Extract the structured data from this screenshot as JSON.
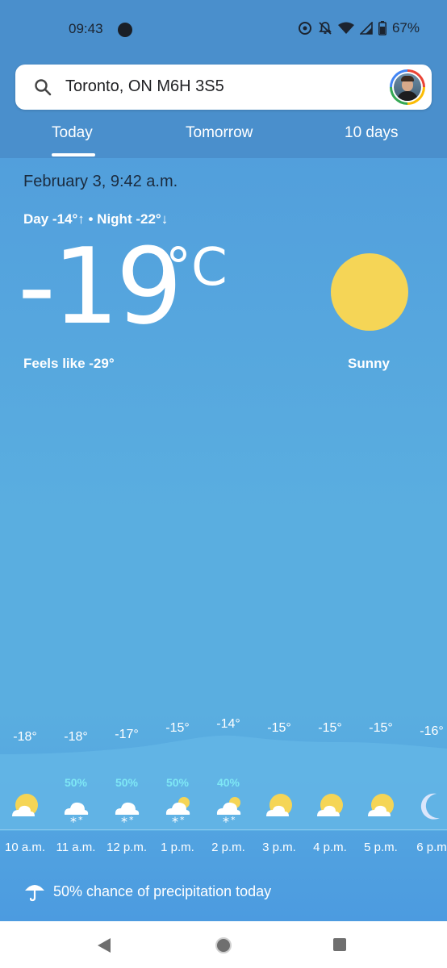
{
  "status_bar": {
    "time": "09:43",
    "battery": "67%"
  },
  "search": {
    "location": "Toronto, ON M6H 3S5"
  },
  "tabs": [
    {
      "label": "Today",
      "selected": true
    },
    {
      "label": "Tomorrow",
      "selected": false
    },
    {
      "label": "10 days",
      "selected": false
    }
  ],
  "current": {
    "date": "February 3, 9:42 a.m.",
    "day_night": "Day -14°↑ • Night -22°↓",
    "temperature": "-19",
    "unit": "°C",
    "feels_like": "Feels like -29°",
    "condition": "Sunny"
  },
  "hourly": [
    {
      "time": "10 a.m.",
      "temp": "-18°",
      "precip": "",
      "icon": "partly-cloudy-sun-icon"
    },
    {
      "time": "11 a.m.",
      "temp": "-18°",
      "precip": "50%",
      "icon": "snow-cloud-icon"
    },
    {
      "time": "12 p.m.",
      "temp": "-17°",
      "precip": "50%",
      "icon": "snow-cloud-icon"
    },
    {
      "time": "1 p.m.",
      "temp": "-15°",
      "precip": "50%",
      "icon": "snow-cloud-sun-icon"
    },
    {
      "time": "2 p.m.",
      "temp": "-14°",
      "precip": "40%",
      "icon": "snow-cloud-sun-icon"
    },
    {
      "time": "3 p.m.",
      "temp": "-15°",
      "precip": "",
      "icon": "partly-cloudy-sun-icon"
    },
    {
      "time": "4 p.m.",
      "temp": "-15°",
      "precip": "",
      "icon": "partly-cloudy-sun-icon"
    },
    {
      "time": "5 p.m.",
      "temp": "-15°",
      "precip": "",
      "icon": "partly-cloudy-sun-icon"
    },
    {
      "time": "6 p.m",
      "temp": "-16°",
      "precip": "",
      "icon": "moon-icon"
    }
  ],
  "precipitation_summary": "50% chance of precipitation today",
  "colors": {
    "header": "#4a8fcc",
    "sun": "#f5d556",
    "precip_text": "#7ee7f5"
  }
}
